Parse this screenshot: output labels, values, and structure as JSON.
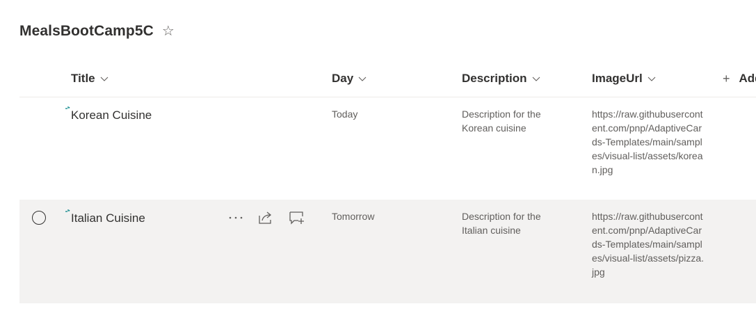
{
  "list": {
    "title": "MealsBootCamp5C",
    "favorite_icon": "star-outline-icon"
  },
  "columns": {
    "title": "Title",
    "day": "Day",
    "description": "Description",
    "imageurl": "ImageUrl",
    "add_column": "Add",
    "sort_icon": "chevron-down-icon"
  },
  "rows": [
    {
      "title": "Korean Cuisine",
      "day": "Today",
      "description": "Description for the Korean cuisine",
      "imageurl": "https://raw.githubusercontent.com/pnp/AdaptiveCards-Templates/main/samples/visual-list/assets/korean.jpg",
      "new_indicator": "new-item-icon"
    },
    {
      "title": "Italian Cuisine",
      "day": "Tomorrow",
      "description": "Description for the Italian cuisine",
      "imageurl": "https://raw.githubusercontent.com/pnp/AdaptiveCards-Templates/main/samples/visual-list/assets/pizza.jpg",
      "new_indicator": "new-item-icon",
      "actions": [
        "more-icon",
        "share-icon",
        "comment-icon"
      ]
    }
  ],
  "colors": {
    "accent": "#0078d4",
    "new_indicator": "#038387",
    "hover_row": "#f3f2f1"
  }
}
